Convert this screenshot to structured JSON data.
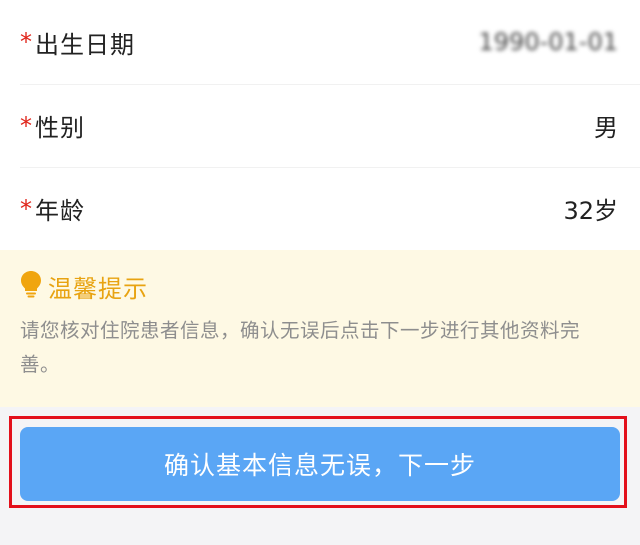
{
  "form": {
    "rows": [
      {
        "required_mark": "*",
        "label": "出生日期",
        "value": "1990-01-01"
      },
      {
        "required_mark": "*",
        "label": "性别",
        "value": "男"
      },
      {
        "required_mark": "*",
        "label": "年龄",
        "value": "32岁"
      }
    ]
  },
  "tip": {
    "icon": "lightbulb-icon",
    "title": "温馨提示",
    "text": "请您核对住院患者信息，确认无误后点击下一步进行其他资料完善。"
  },
  "actions": {
    "confirm_label": "确认基本信息无误，下一步"
  },
  "colors": {
    "required": "#e0241a",
    "tip_title": "#e8a311",
    "tip_background": "#fef9e4",
    "button": "#5aa6f5",
    "highlight": "#e3101b"
  }
}
